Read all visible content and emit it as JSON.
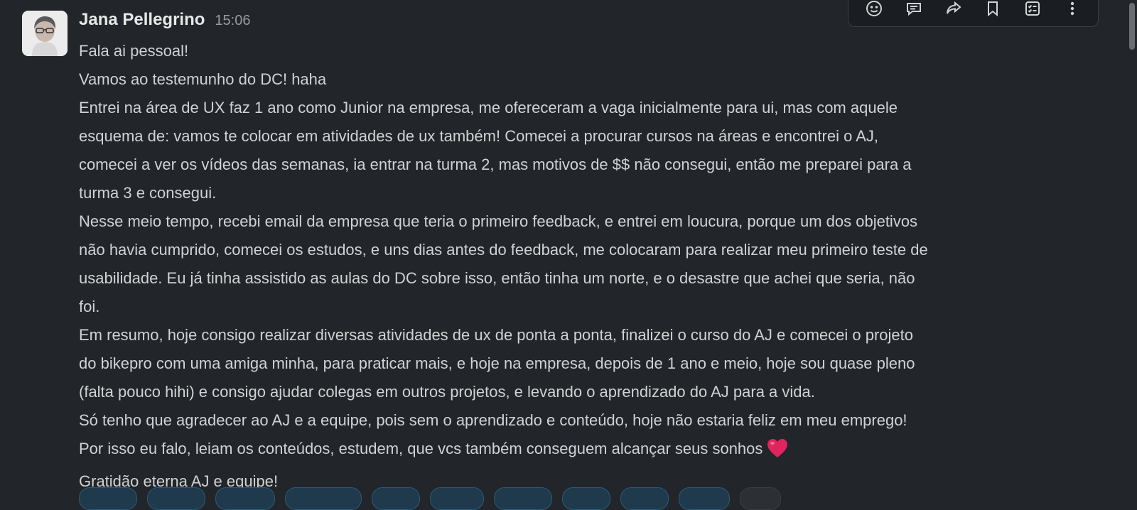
{
  "message": {
    "author": "Jana Pellegrino",
    "time": "15:06",
    "lines": [
      "Fala ai pessoal!",
      "Vamos ao testemunho do DC! haha",
      "Entrei na área de UX faz 1 ano como Junior na empresa, me ofereceram a vaga inicialmente para ui, mas com aquele",
      "esquema de: vamos te colocar em atividades de ux também! Comecei a procurar cursos na áreas e encontrei o AJ,",
      "comecei a ver os vídeos das semanas, ia entrar na turma 2, mas motivos de $$ não consegui, então me preparei para a",
      "turma 3 e consegui.",
      "Nesse meio tempo, recebi email da empresa que teria o primeiro feedback, e entrei em loucura, porque um dos objetivos",
      "não havia cumprido, comecei os estudos, e uns dias antes do feedback, me colocaram para realizar meu primeiro teste de",
      "usabilidade. Eu já tinha assistido as aulas do DC sobre isso, então tinha um norte, e o desastre que achei que seria, não",
      "foi.",
      "Em resumo, hoje consigo realizar diversas atividades de ux de ponta a ponta, finalizei o curso do AJ e comecei o projeto",
      "do bikepro com uma amiga minha, para praticar mais, e hoje na empresa, depois de 1 ano e meio, hoje sou quase pleno",
      "(falta pouco hihi) e consigo ajudar colegas em outros projetos, e levando o aprendizado do AJ para a vida.",
      "Só tenho que agradecer ao AJ e a equipe, pois sem o aprendizado e conteúdo, hoje não estaria feliz em meu emprego!",
      "Por isso eu falo, leiam os conteúdos, estudem, que vcs também conseguem alcançar seus sonhos",
      "Gratidão eterna AJ e equipe!"
    ],
    "emoji_after_line_15": "heart-emoji"
  },
  "toolbar": {
    "buttons": [
      "emoji-reaction-icon",
      "reply-thread-icon",
      "forward-icon",
      "bookmark-icon",
      "checklist-icon",
      "more-actions-icon"
    ]
  },
  "colors": {
    "background": "#222529",
    "text": "#d1d2d3",
    "heart": "#e0245e",
    "reaction_pill": "#1f3a4d"
  }
}
